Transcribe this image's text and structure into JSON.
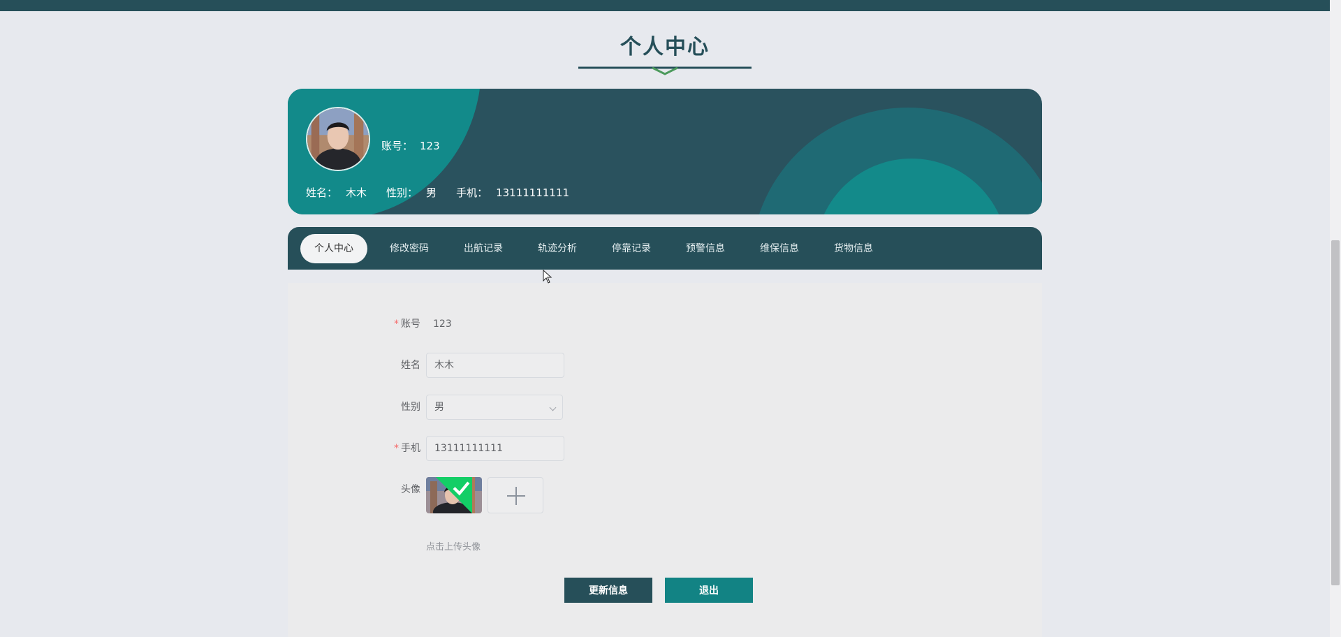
{
  "header": {
    "title": "个人中心"
  },
  "profile": {
    "account_label": "账号：",
    "account": "123",
    "name_label": "姓名：",
    "name": "木木",
    "gender_label": "性别：",
    "gender": "男",
    "phone_label": "手机：",
    "phone": "13111111111"
  },
  "tabs": [
    {
      "label": "个人中心",
      "active": true
    },
    {
      "label": "修改密码"
    },
    {
      "label": "出航记录"
    },
    {
      "label": "轨迹分析"
    },
    {
      "label": "停靠记录"
    },
    {
      "label": "预警信息"
    },
    {
      "label": "维保信息"
    },
    {
      "label": "货物信息"
    }
  ],
  "form": {
    "account": {
      "label": "账号",
      "required": "*",
      "value": "123"
    },
    "name": {
      "label": "姓名",
      "value": "木木"
    },
    "gender": {
      "label": "性别",
      "value": "男"
    },
    "phone": {
      "label": "手机",
      "required": "*",
      "value": "13111111111"
    },
    "avatar": {
      "label": "头像",
      "hint": "点击上传头像"
    }
  },
  "buttons": {
    "update": "更新信息",
    "logout": "退出"
  },
  "colors": {
    "primary": "#264f59",
    "accent": "#128384",
    "teal": "#138a8a"
  },
  "icons": [
    "plus-icon",
    "check-icon",
    "chevron-down-icon",
    "mouse-cursor-icon"
  ]
}
